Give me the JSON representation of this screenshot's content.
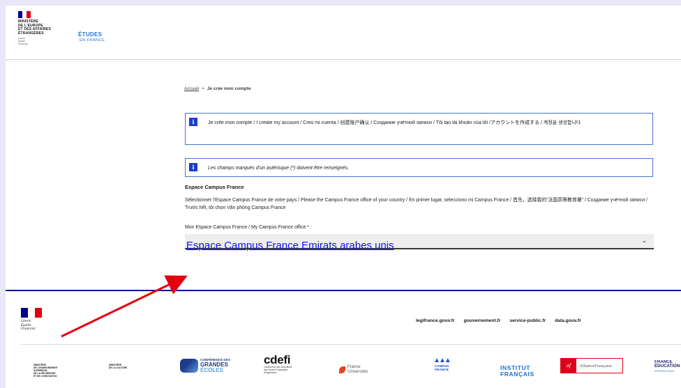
{
  "header": {
    "ministry_lines": [
      "MINISTÈRE",
      "DE L'EUROPE",
      "ET DES AFFAIRES",
      "ÉTRANGÈRES"
    ],
    "devise_lines": [
      "Liberté",
      "Égalité",
      "Fraternité"
    ],
    "logo_line1": "ÉTUDES",
    "logo_line2": "EN FRANCE"
  },
  "breadcrumb": {
    "home": "Accueil",
    "separator": ">",
    "current": "Je crée mon compte"
  },
  "notices": {
    "create_account": "Je crée mon compte / I create my account / Creo mi cuenta / 创建账户确认 / Создание учётной записи / Tôi tạo tài khoản của tôi /アカウントを作成する / 계정을 생성합니다",
    "required_fields": "Les champs marqués d'un astérisque (*) doivent être renseignés.",
    "info_icon": "i"
  },
  "form": {
    "section_title": "Espace Campus France",
    "section_desc": "Sélectionner l'Espace Campus France de votre pays / Please the Campus France office of your country / En primer lugar, selecciono mi Campus France / 首先，选择我的“法国高等教育署” / Создание учётной записи / Trước hết, tôi chọn Văn phòng Campus France",
    "select_label": "Mon Espace Campus France / My Campus France office * :",
    "select_value": "Espace Campus France Emirats arabes unis",
    "chevron_icon": "chevron-down-icon"
  },
  "footer": {
    "devise_lines": [
      "Liberté",
      "Égalité",
      "Fraternité"
    ],
    "links": [
      "legifrance.gouv.fr",
      "gouvernement.fr",
      "service-public.fr",
      "data.gouv.fr"
    ],
    "partners": {
      "mesr": [
        "MINISTÈRE",
        "DE L'ENSEIGNEMENT",
        "SUPÉRIEUR,",
        "DE LA RECHERCHE",
        "ET DE L'INNOVATION"
      ],
      "culture": [
        "MINISTÈRE",
        "DE LA CULTURE"
      ],
      "cge": [
        "CONFÉRENCE DES",
        "GRANDES",
        "ÉCOLES"
      ],
      "cdefi_big": "cdefi",
      "cdefi_small": [
        "Conférence des Directeurs",
        "des Écoles Françaises",
        "d'Ingénieurs"
      ],
      "fu": [
        "France",
        "Universités"
      ],
      "cf": [
        "CAMPUS",
        "FRANCE"
      ],
      "if": [
        "INSTITUT",
        "FRANÇAIS"
      ],
      "af_mark": "af",
      "af_name": "AllianceFrançaise",
      "fe": [
        "FRANCE",
        "ÉDUCATION",
        "INTERNATIONAL"
      ]
    }
  },
  "colors": {
    "accent_blue": "#000091",
    "link_blue": "#1212ff",
    "notice_border": "#4a72d4",
    "arrow_red": "#e3000f"
  }
}
